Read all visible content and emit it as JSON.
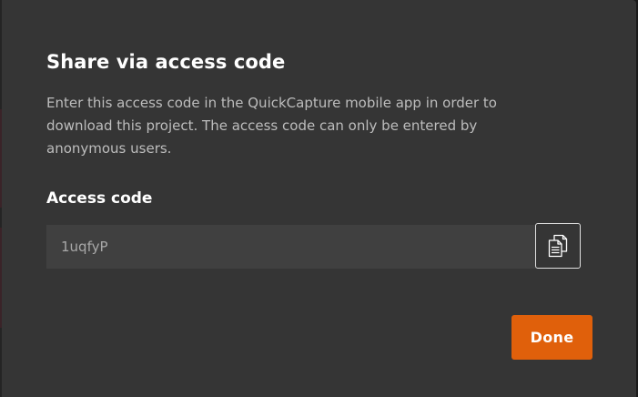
{
  "dialog": {
    "title": "Share via access code",
    "description": "Enter this access code in the QuickCapture mobile app in order to download this project. The access code can only be entered by anonymous users.",
    "field_label": "Access code",
    "access_code": "1uqfyP",
    "copy_icon": "copy-icon",
    "done_label": "Done"
  },
  "colors": {
    "dialog_background": "#353535",
    "input_background": "#404040",
    "primary_button": "#e0600b",
    "title_text": "#ffffff",
    "body_text": "#bdbdbd"
  }
}
